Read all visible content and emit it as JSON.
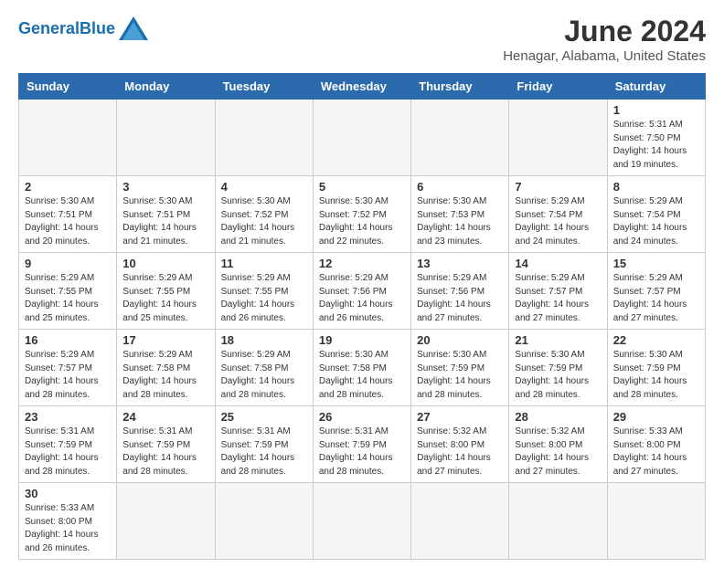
{
  "logo": {
    "text_general": "General",
    "text_blue": "Blue"
  },
  "title": "June 2024",
  "location": "Henagar, Alabama, United States",
  "days_of_week": [
    "Sunday",
    "Monday",
    "Tuesday",
    "Wednesday",
    "Thursday",
    "Friday",
    "Saturday"
  ],
  "weeks": [
    [
      {
        "day": "",
        "info": ""
      },
      {
        "day": "",
        "info": ""
      },
      {
        "day": "",
        "info": ""
      },
      {
        "day": "",
        "info": ""
      },
      {
        "day": "",
        "info": ""
      },
      {
        "day": "",
        "info": ""
      },
      {
        "day": "1",
        "info": "Sunrise: 5:31 AM\nSunset: 7:50 PM\nDaylight: 14 hours\nand 19 minutes."
      }
    ],
    [
      {
        "day": "2",
        "info": "Sunrise: 5:30 AM\nSunset: 7:51 PM\nDaylight: 14 hours\nand 20 minutes."
      },
      {
        "day": "3",
        "info": "Sunrise: 5:30 AM\nSunset: 7:51 PM\nDaylight: 14 hours\nand 21 minutes."
      },
      {
        "day": "4",
        "info": "Sunrise: 5:30 AM\nSunset: 7:52 PM\nDaylight: 14 hours\nand 21 minutes."
      },
      {
        "day": "5",
        "info": "Sunrise: 5:30 AM\nSunset: 7:52 PM\nDaylight: 14 hours\nand 22 minutes."
      },
      {
        "day": "6",
        "info": "Sunrise: 5:30 AM\nSunset: 7:53 PM\nDaylight: 14 hours\nand 23 minutes."
      },
      {
        "day": "7",
        "info": "Sunrise: 5:29 AM\nSunset: 7:54 PM\nDaylight: 14 hours\nand 24 minutes."
      },
      {
        "day": "8",
        "info": "Sunrise: 5:29 AM\nSunset: 7:54 PM\nDaylight: 14 hours\nand 24 minutes."
      }
    ],
    [
      {
        "day": "9",
        "info": "Sunrise: 5:29 AM\nSunset: 7:55 PM\nDaylight: 14 hours\nand 25 minutes."
      },
      {
        "day": "10",
        "info": "Sunrise: 5:29 AM\nSunset: 7:55 PM\nDaylight: 14 hours\nand 25 minutes."
      },
      {
        "day": "11",
        "info": "Sunrise: 5:29 AM\nSunset: 7:55 PM\nDaylight: 14 hours\nand 26 minutes."
      },
      {
        "day": "12",
        "info": "Sunrise: 5:29 AM\nSunset: 7:56 PM\nDaylight: 14 hours\nand 26 minutes."
      },
      {
        "day": "13",
        "info": "Sunrise: 5:29 AM\nSunset: 7:56 PM\nDaylight: 14 hours\nand 27 minutes."
      },
      {
        "day": "14",
        "info": "Sunrise: 5:29 AM\nSunset: 7:57 PM\nDaylight: 14 hours\nand 27 minutes."
      },
      {
        "day": "15",
        "info": "Sunrise: 5:29 AM\nSunset: 7:57 PM\nDaylight: 14 hours\nand 27 minutes."
      }
    ],
    [
      {
        "day": "16",
        "info": "Sunrise: 5:29 AM\nSunset: 7:57 PM\nDaylight: 14 hours\nand 28 minutes."
      },
      {
        "day": "17",
        "info": "Sunrise: 5:29 AM\nSunset: 7:58 PM\nDaylight: 14 hours\nand 28 minutes."
      },
      {
        "day": "18",
        "info": "Sunrise: 5:29 AM\nSunset: 7:58 PM\nDaylight: 14 hours\nand 28 minutes."
      },
      {
        "day": "19",
        "info": "Sunrise: 5:30 AM\nSunset: 7:58 PM\nDaylight: 14 hours\nand 28 minutes."
      },
      {
        "day": "20",
        "info": "Sunrise: 5:30 AM\nSunset: 7:59 PM\nDaylight: 14 hours\nand 28 minutes."
      },
      {
        "day": "21",
        "info": "Sunrise: 5:30 AM\nSunset: 7:59 PM\nDaylight: 14 hours\nand 28 minutes."
      },
      {
        "day": "22",
        "info": "Sunrise: 5:30 AM\nSunset: 7:59 PM\nDaylight: 14 hours\nand 28 minutes."
      }
    ],
    [
      {
        "day": "23",
        "info": "Sunrise: 5:31 AM\nSunset: 7:59 PM\nDaylight: 14 hours\nand 28 minutes."
      },
      {
        "day": "24",
        "info": "Sunrise: 5:31 AM\nSunset: 7:59 PM\nDaylight: 14 hours\nand 28 minutes."
      },
      {
        "day": "25",
        "info": "Sunrise: 5:31 AM\nSunset: 7:59 PM\nDaylight: 14 hours\nand 28 minutes."
      },
      {
        "day": "26",
        "info": "Sunrise: 5:31 AM\nSunset: 7:59 PM\nDaylight: 14 hours\nand 28 minutes."
      },
      {
        "day": "27",
        "info": "Sunrise: 5:32 AM\nSunset: 8:00 PM\nDaylight: 14 hours\nand 27 minutes."
      },
      {
        "day": "28",
        "info": "Sunrise: 5:32 AM\nSunset: 8:00 PM\nDaylight: 14 hours\nand 27 minutes."
      },
      {
        "day": "29",
        "info": "Sunrise: 5:33 AM\nSunset: 8:00 PM\nDaylight: 14 hours\nand 27 minutes."
      }
    ],
    [
      {
        "day": "30",
        "info": "Sunrise: 5:33 AM\nSunset: 8:00 PM\nDaylight: 14 hours\nand 26 minutes."
      },
      {
        "day": "",
        "info": ""
      },
      {
        "day": "",
        "info": ""
      },
      {
        "day": "",
        "info": ""
      },
      {
        "day": "",
        "info": ""
      },
      {
        "day": "",
        "info": ""
      },
      {
        "day": "",
        "info": ""
      }
    ]
  ]
}
